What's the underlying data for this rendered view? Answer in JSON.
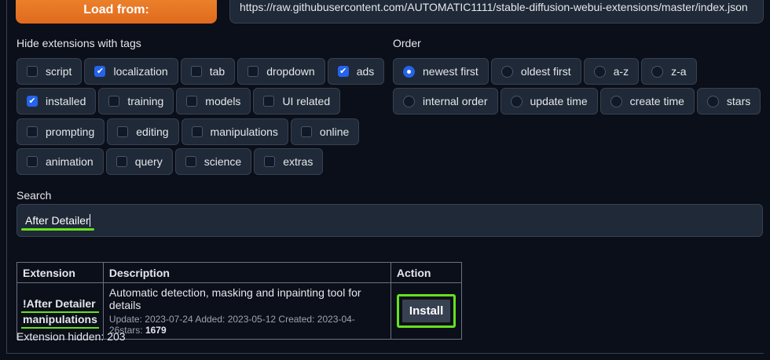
{
  "load": {
    "label": "Load from:"
  },
  "url": {
    "value": "https://raw.githubusercontent.com/AUTOMATIC1111/stable-diffusion-webui-extensions/master/index.json"
  },
  "hide": {
    "label": "Hide extensions with tags",
    "rows": [
      [
        {
          "label": "script",
          "checked": false
        },
        {
          "label": "localization",
          "checked": true
        },
        {
          "label": "tab",
          "checked": false
        },
        {
          "label": "dropdown",
          "checked": false
        },
        {
          "label": "ads",
          "checked": true
        }
      ],
      [
        {
          "label": "installed",
          "checked": true
        },
        {
          "label": "training",
          "checked": false
        },
        {
          "label": "models",
          "checked": false
        },
        {
          "label": "UI related",
          "checked": false
        }
      ],
      [
        {
          "label": "prompting",
          "checked": false
        },
        {
          "label": "editing",
          "checked": false
        },
        {
          "label": "manipulations",
          "checked": false
        },
        {
          "label": "online",
          "checked": false
        }
      ],
      [
        {
          "label": "animation",
          "checked": false
        },
        {
          "label": "query",
          "checked": false
        },
        {
          "label": "science",
          "checked": false
        },
        {
          "label": "extras",
          "checked": false
        }
      ]
    ]
  },
  "order": {
    "label": "Order",
    "rows": [
      [
        {
          "label": "newest first",
          "selected": true
        },
        {
          "label": "oldest first",
          "selected": false
        },
        {
          "label": "a-z",
          "selected": false
        },
        {
          "label": "z-a",
          "selected": false
        }
      ],
      [
        {
          "label": "internal order",
          "selected": false
        },
        {
          "label": "update time",
          "selected": false
        },
        {
          "label": "create time",
          "selected": false
        },
        {
          "label": "stars",
          "selected": false
        }
      ]
    ]
  },
  "search": {
    "label": "Search",
    "value": "After Detailer"
  },
  "table": {
    "headers": [
      "Extension",
      "Description",
      "Action"
    ],
    "row": {
      "name": "!After Detailer",
      "tag": "manipulations",
      "description": "Automatic detection, masking and inpainting tool for details",
      "meta_prefix": "Update: 2023-07-24 Added: 2023-05-12 Created: 2023-04-26stars: ",
      "stars": "1679",
      "action": "Install"
    }
  },
  "hidden": {
    "text": "Extension hidden: 203"
  },
  "colors": {
    "accent": "#2563eb",
    "highlight": "#65e21e",
    "load_button": "#e57a24"
  },
  "icons": {
    "checkbox_checked": "check-icon",
    "radio_selected": "radio-dot-icon"
  }
}
